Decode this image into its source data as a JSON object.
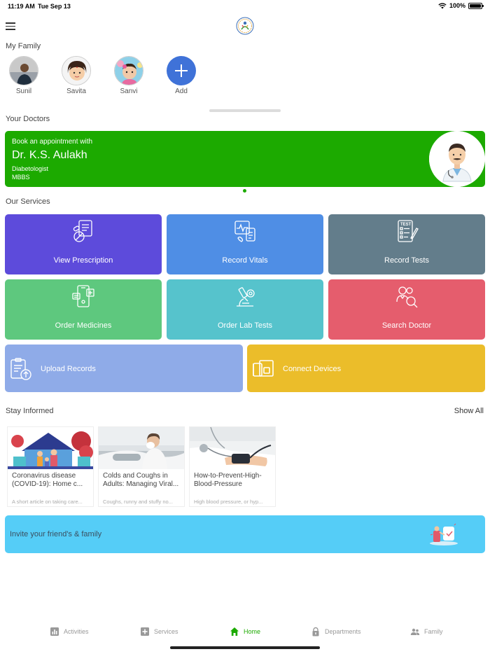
{
  "status": {
    "time": "11:19 AM",
    "date": "Tue Sep 13",
    "battery": "100%"
  },
  "family": {
    "title": "My Family",
    "members": [
      {
        "name": "Sunil"
      },
      {
        "name": "Savita"
      },
      {
        "name": "Sanvi"
      }
    ],
    "add_label": "Add"
  },
  "doctors": {
    "title": "Your Doctors",
    "card": {
      "book_text": "Book an appointment with",
      "name": "Dr. K.S. Aulakh",
      "specialty": "Diabetologist",
      "degree": "MBBS"
    }
  },
  "services": {
    "title": "Our Services",
    "tiles": [
      {
        "label": "View Prescription",
        "color": "#5d4bdb"
      },
      {
        "label": "Record Vitals",
        "color": "#4f8ee5"
      },
      {
        "label": "Record Tests",
        "color": "#637d8b"
      },
      {
        "label": "Order Medicines",
        "color": "#5ec87e"
      },
      {
        "label": "Order Lab Tests",
        "color": "#56c3cc"
      },
      {
        "label": "Search Doctor",
        "color": "#e55d6d"
      }
    ],
    "wide_tiles": [
      {
        "label": "Upload Records",
        "color": "#8fabe8"
      },
      {
        "label": "Connect Devices",
        "color": "#ebbd2a"
      }
    ]
  },
  "informed": {
    "title": "Stay Informed",
    "show_all": "Show All",
    "articles": [
      {
        "title": "Coronavirus disease (COVID-19): Home c...",
        "desc": "A short article on taking care..."
      },
      {
        "title": "Colds and Coughs in Adults: Managing Viral...",
        "desc": "Coughs, runny and stuffy no..."
      },
      {
        "title": "How-to-Prevent-High-Blood-Pressure",
        "desc": "High blood pressure, or hyp..."
      }
    ]
  },
  "invite": {
    "label": "Invite your friend's & family"
  },
  "tabs": [
    {
      "label": "Activities",
      "icon": "bar-chart-icon"
    },
    {
      "label": "Services",
      "icon": "plus-square-icon"
    },
    {
      "label": "Home",
      "icon": "home-icon"
    },
    {
      "label": "Departments",
      "icon": "lock-icon"
    },
    {
      "label": "Family",
      "icon": "people-icon"
    }
  ],
  "colors": {
    "accent_green": "#1caa00",
    "add_blue": "#3f72d8",
    "invite_blue": "#55cdf7"
  }
}
